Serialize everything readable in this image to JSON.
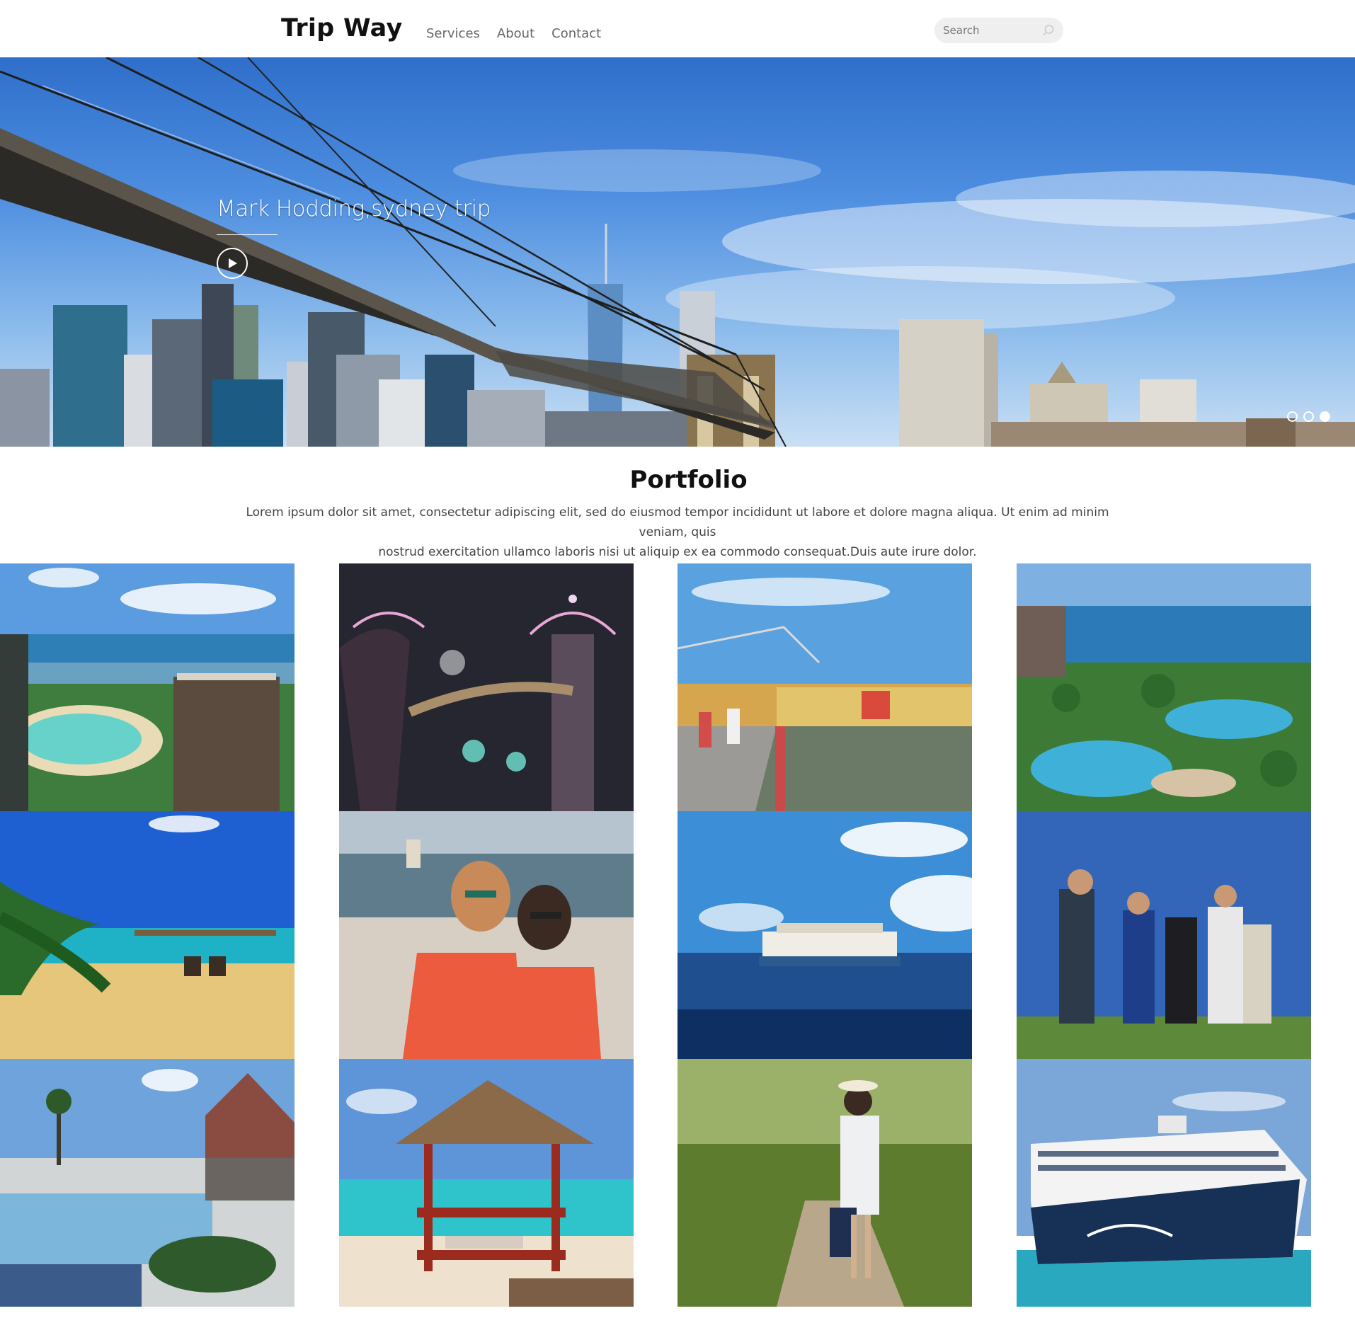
{
  "header": {
    "logo": "Trip Way",
    "nav": [
      "Services",
      "About",
      "Contact"
    ],
    "search_placeholder": "Search"
  },
  "hero": {
    "caption": "Mark Hodding,sydney trip",
    "slides_total": 3,
    "active_slide": 3
  },
  "portfolio": {
    "title": "Portfolio",
    "description_line1": "Lorem ipsum dolor sit amet, consectetur adipiscing elit, sed do eiusmod tempor incididunt ut labore et dolore magna aliqua. Ut enim ad minim veniam, quis",
    "description_line2": "nostrud exercitation ullamco laboris nisi ut aliquip ex ea commodo consequat.Duis aute irure dolor."
  },
  "colors": {
    "sky": "#3a7fd5",
    "sea": "#1e8fc4",
    "sand": "#e4c98a",
    "accent_red": "#e5553b"
  }
}
